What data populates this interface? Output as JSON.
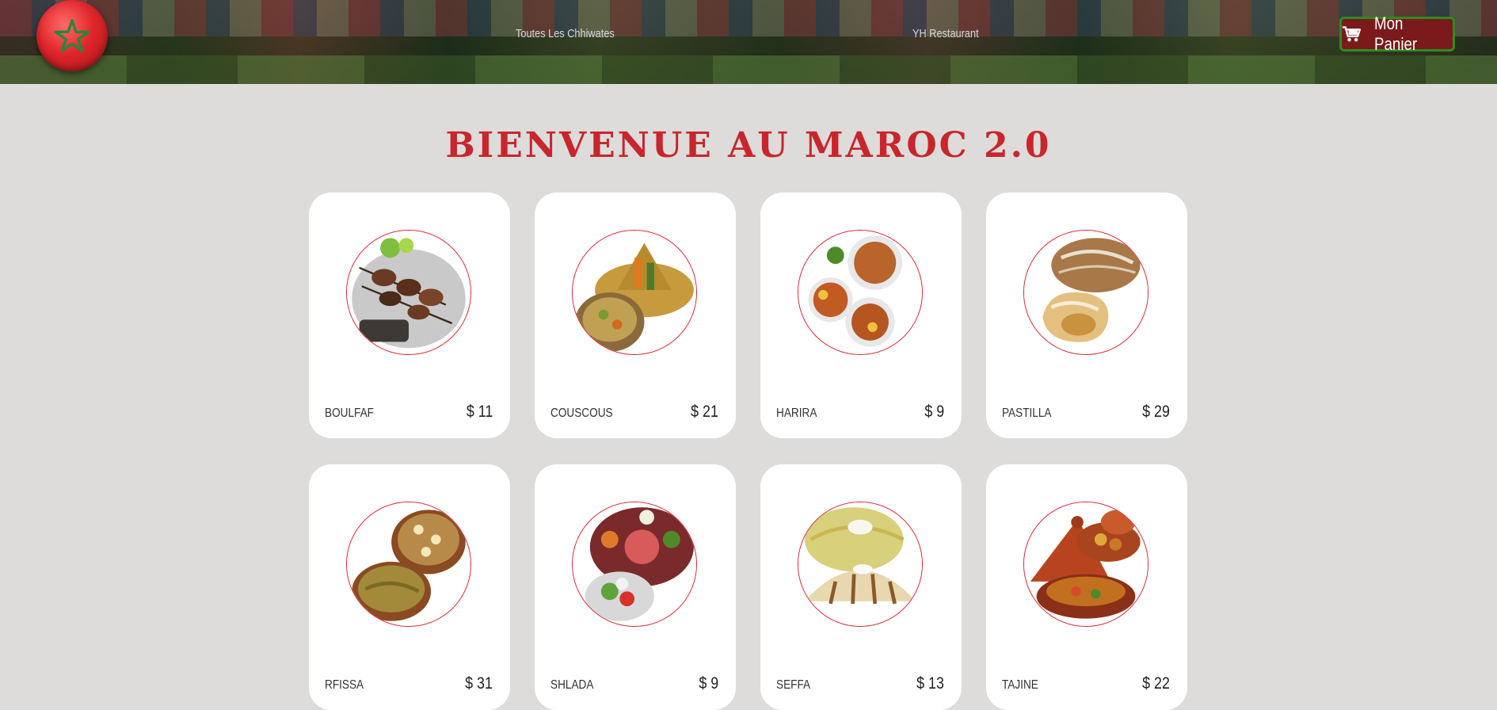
{
  "header": {
    "nav": [
      {
        "label": "Toutes Les Chhiwates"
      },
      {
        "label": "YH Restaurant"
      }
    ],
    "cart_label": "Mon Panier",
    "logo_icon": "morocco-flag-icon"
  },
  "page": {
    "title": "BIENVENUE AU MAROC 2.0"
  },
  "colors": {
    "accent": "#c8262b",
    "cart_border": "#2e8b1f",
    "background": "#dddcdb"
  },
  "dishes": [
    {
      "name": "BOULFAF",
      "price": "$ 11",
      "icon": "skewers-icon"
    },
    {
      "name": "COUSCOUS",
      "price": "$ 21",
      "icon": "couscous-icon"
    },
    {
      "name": "HARIRA",
      "price": "$ 9",
      "icon": "soup-icon"
    },
    {
      "name": "PASTILLA",
      "price": "$ 29",
      "icon": "pie-icon"
    },
    {
      "name": "RFISSA",
      "price": "$ 31",
      "icon": "rfissa-icon"
    },
    {
      "name": "SHLADA",
      "price": "$ 9",
      "icon": "salad-icon"
    },
    {
      "name": "SEFFA",
      "price": "$ 13",
      "icon": "seffa-icon"
    },
    {
      "name": "TAJINE",
      "price": "$ 22",
      "icon": "tajine-icon"
    }
  ]
}
